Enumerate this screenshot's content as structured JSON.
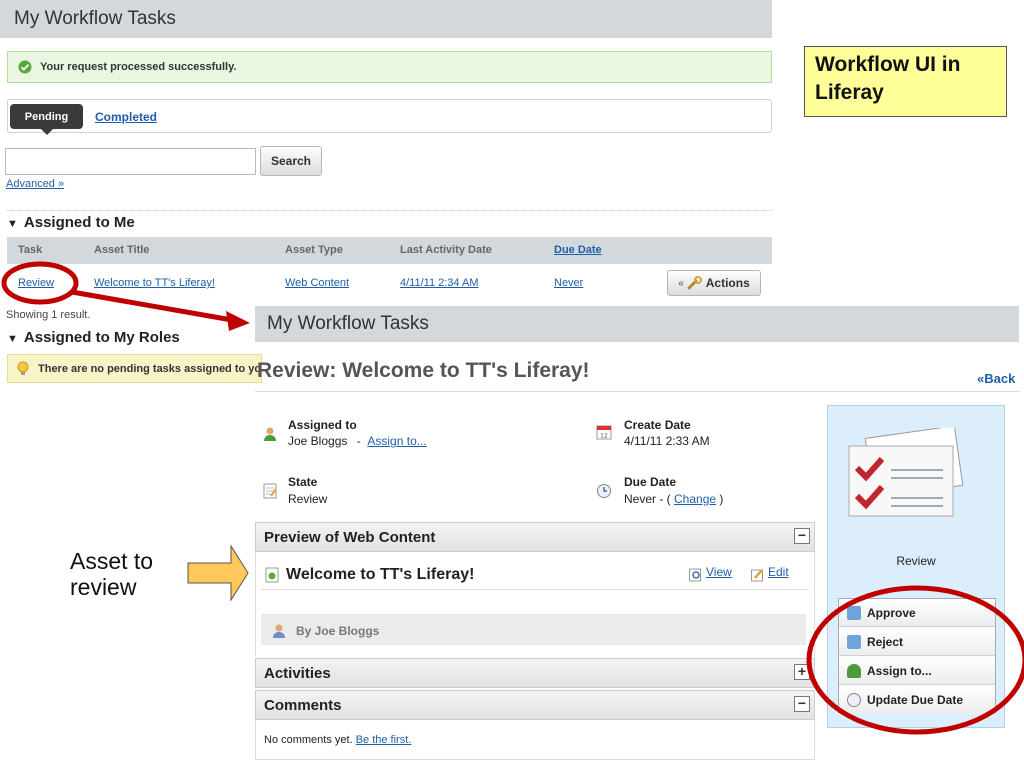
{
  "list_portlet": {
    "title": "My Workflow Tasks",
    "success_message": "Your request processed successfully.",
    "tabs": {
      "pending": "Pending",
      "completed": "Completed"
    },
    "search": {
      "value": "",
      "button": "Search",
      "advanced": "Advanced »"
    },
    "assigned_to_me": {
      "heading": "Assigned to Me",
      "columns": [
        "Task",
        "Asset Title",
        "Asset Type",
        "Last Activity Date",
        "Due Date"
      ],
      "row": {
        "task": "Review",
        "asset_title": "Welcome to TT's Liferay!",
        "asset_type": "Web Content",
        "last_activity": "4/11/11 2:34 AM",
        "due_date": "Never",
        "actions": "Actions"
      },
      "result_count": "Showing 1 result."
    },
    "assigned_to_roles": {
      "heading": "Assigned to My Roles",
      "message": "There are no pending tasks assigned to your roles."
    }
  },
  "callout": {
    "line1": "Workflow UI in",
    "line2": "Liferay"
  },
  "asset_label": {
    "line1": "Asset to",
    "line2": "review"
  },
  "detail_portlet": {
    "title": "My Workflow Tasks",
    "heading": "Review: Welcome to TT's Liferay!",
    "back": "«Back",
    "assigned_to": {
      "label": "Assigned to",
      "value": "Joe Bloggs",
      "sep": "-",
      "link": "Assign to..."
    },
    "create_date": {
      "label": "Create Date",
      "value": "4/11/11 2:33 AM"
    },
    "state": {
      "label": "State",
      "value": "Review"
    },
    "due_date": {
      "label": "Due Date",
      "value": "Never - (",
      "link": "Change",
      "close": ")"
    },
    "preview": {
      "heading": "Preview of Web Content",
      "content_title": "Welcome to TT's Liferay!",
      "view": "View",
      "edit": "Edit",
      "author": "By Joe Bloggs"
    },
    "activities": {
      "heading": "Activities"
    },
    "comments": {
      "heading": "Comments",
      "empty": "No comments yet.",
      "first_link": "Be the first."
    },
    "sidebar": {
      "state_label": "Review",
      "actions": [
        "Approve",
        "Reject",
        "Assign to...",
        "Update Due Date"
      ]
    }
  },
  "colors": {
    "highlight_red": "#c00000",
    "callout_yellow": "#ffff99",
    "arrow_orange": "#ffc85a"
  }
}
